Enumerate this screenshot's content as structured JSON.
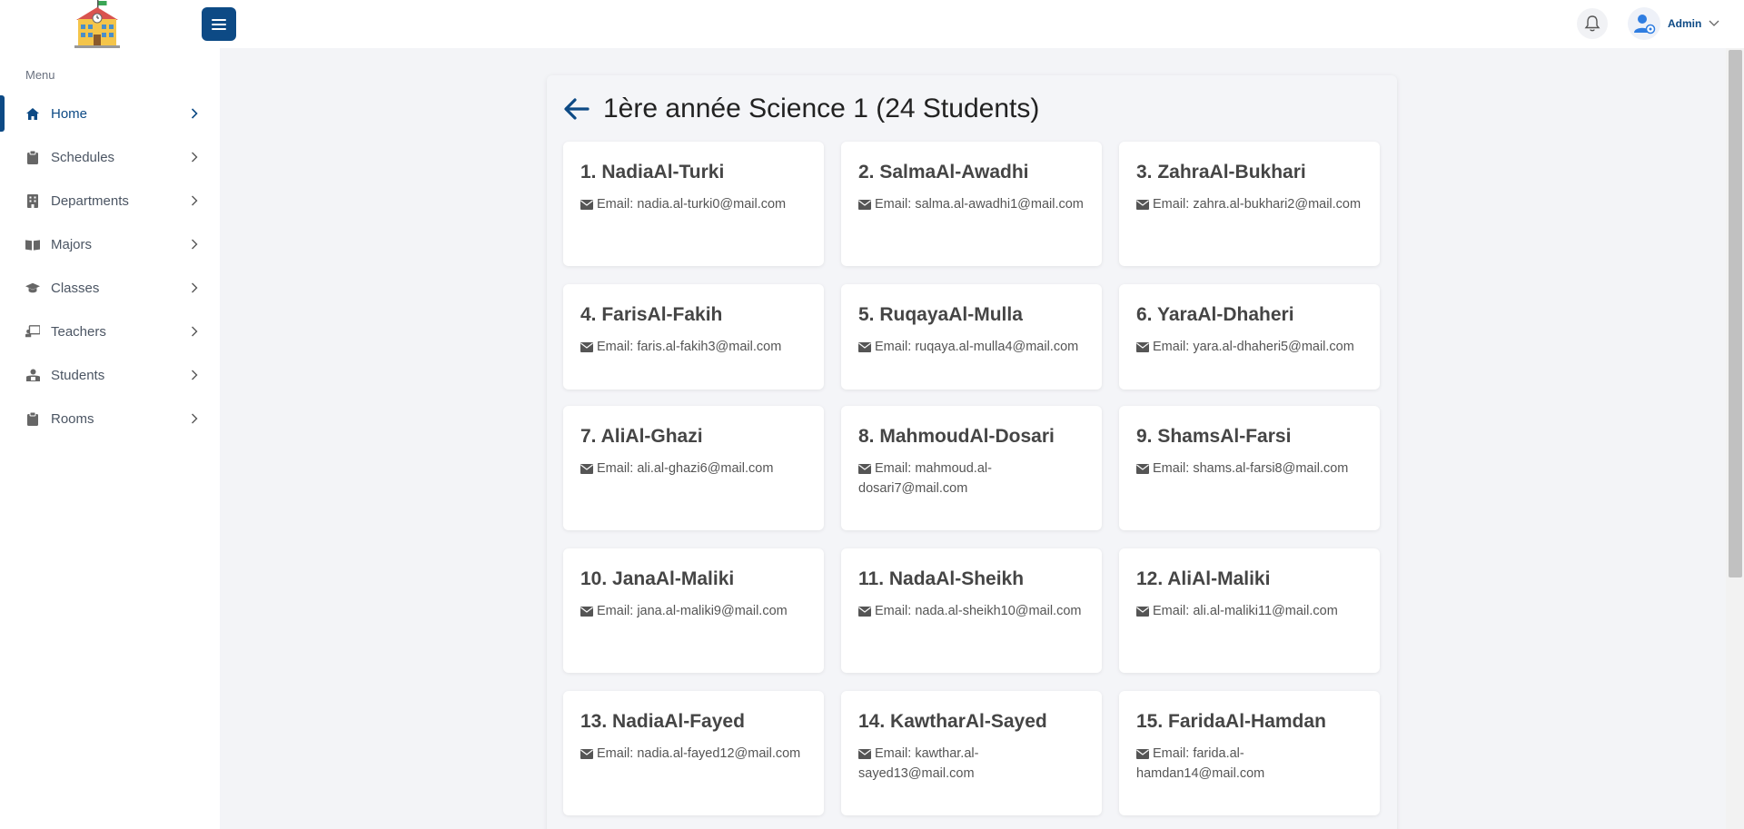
{
  "topbar": {
    "user_name": "Admin"
  },
  "sidebar": {
    "menu_title": "Menu",
    "items": [
      {
        "label": "Home",
        "icon": "home-icon"
      },
      {
        "label": "Schedules",
        "icon": "clipboard-icon"
      },
      {
        "label": "Departments",
        "icon": "building-icon"
      },
      {
        "label": "Majors",
        "icon": "book-icon"
      },
      {
        "label": "Classes",
        "icon": "graduation-cap-icon"
      },
      {
        "label": "Teachers",
        "icon": "chalkboard-teacher-icon"
      },
      {
        "label": "Students",
        "icon": "student-icon"
      },
      {
        "label": "Rooms",
        "icon": "clipboard-icon"
      }
    ]
  },
  "main": {
    "title": "1ère année Science 1 (24 Students)",
    "students": [
      {
        "name": "1. NadiaAl-Turki",
        "email": "Email: nadia.al-turki0@mail.com"
      },
      {
        "name": "2. SalmaAl-Awadhi",
        "email": "Email: salma.al-awadhi1@mail.com"
      },
      {
        "name": "3. ZahraAl-Bukhari",
        "email": "Email: zahra.al-bukhari2@mail.com"
      },
      {
        "name": "4. FarisAl-Fakih",
        "email": "Email: faris.al-fakih3@mail.com"
      },
      {
        "name": "5. RuqayaAl-Mulla",
        "email": "Email: ruqaya.al-mulla4@mail.com"
      },
      {
        "name": "6. YaraAl-Dhaheri",
        "email": "Email: yara.al-dhaheri5@mail.com"
      },
      {
        "name": "7. AliAl-Ghazi",
        "email": "Email: ali.al-ghazi6@mail.com"
      },
      {
        "name": "8. MahmoudAl-Dosari",
        "email": "Email: mahmoud.al-dosari7@mail.com"
      },
      {
        "name": "9. ShamsAl-Farsi",
        "email": "Email: shams.al-farsi8@mail.com"
      },
      {
        "name": "10. JanaAl-Maliki",
        "email": "Email: jana.al-maliki9@mail.com"
      },
      {
        "name": "11. NadaAl-Sheikh",
        "email": "Email: nada.al-sheikh10@mail.com"
      },
      {
        "name": "12. AliAl-Maliki",
        "email": "Email: ali.al-maliki11@mail.com"
      },
      {
        "name": "13. NadiaAl-Fayed",
        "email": "Email: nadia.al-fayed12@mail.com"
      },
      {
        "name": "14. KawtharAl-Sayed",
        "email": "Email: kawthar.al-sayed13@mail.com"
      },
      {
        "name": "15. FaridaAl-Hamdan",
        "email": "Email: farida.al-hamdan14@mail.com"
      }
    ]
  },
  "colors": {
    "primary": "#0d4a85",
    "background": "#f3f4f7"
  }
}
